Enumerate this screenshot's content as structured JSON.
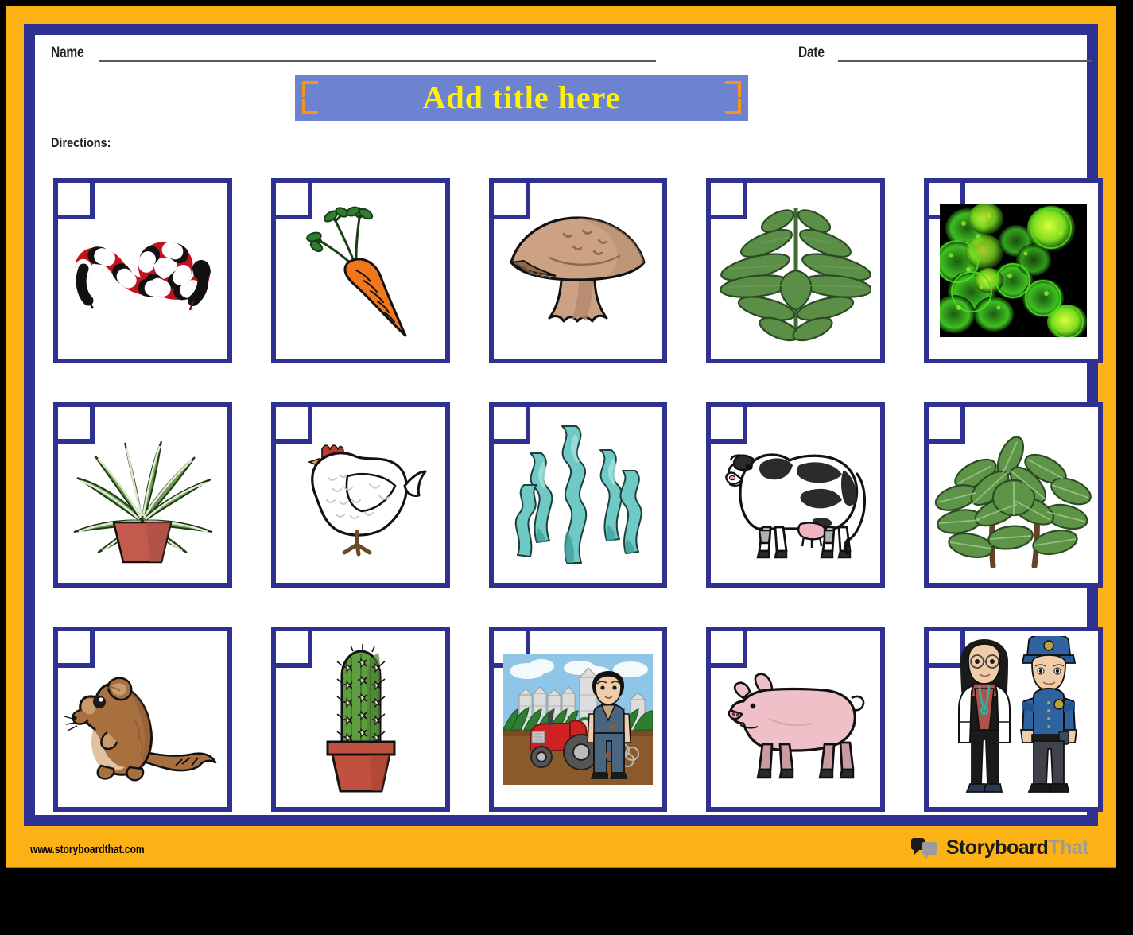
{
  "worksheet": {
    "name_label": "Name",
    "date_label": "Date",
    "title": "Add title here",
    "directions_label": "Directions:"
  },
  "footer": {
    "url": "www.storyboardthat.com",
    "logo_primary": "Storyboard",
    "logo_secondary": "That",
    "logo_icon": "speech-bubbles-icon"
  },
  "colors": {
    "outer_frame": "#FCB215",
    "inner_frame": "#2E3192",
    "title_bg": "#6D83D0",
    "title_text": "#FFF200",
    "corner_bracket": "#F7941E",
    "page_bg": "#FFFFFF"
  },
  "grid": {
    "rows": 3,
    "columns": 5,
    "cards": [
      {
        "index": 1,
        "icon": "snake-icon",
        "label": "snake",
        "checkbox_checked": false
      },
      {
        "index": 2,
        "icon": "carrot-icon",
        "label": "carrot",
        "checkbox_checked": false
      },
      {
        "index": 3,
        "icon": "mushroom-icon",
        "label": "mushroom",
        "checkbox_checked": false
      },
      {
        "index": 4,
        "icon": "leafy-plant-icon",
        "label": "leafy plant",
        "checkbox_checked": false
      },
      {
        "index": 5,
        "icon": "bacteria-micrograph-icon",
        "label": "bacteria micrograph",
        "checkbox_checked": false
      },
      {
        "index": 6,
        "icon": "spider-plant-icon",
        "label": "potted spider plant",
        "checkbox_checked": false
      },
      {
        "index": 7,
        "icon": "chicken-icon",
        "label": "chicken",
        "checkbox_checked": false
      },
      {
        "index": 8,
        "icon": "seaweed-icon",
        "label": "seaweed",
        "checkbox_checked": false
      },
      {
        "index": 9,
        "icon": "cow-icon",
        "label": "cow",
        "checkbox_checked": false
      },
      {
        "index": 10,
        "icon": "leafy-branch-icon",
        "label": "leafy branch",
        "checkbox_checked": false
      },
      {
        "index": 11,
        "icon": "mouse-icon",
        "label": "mouse",
        "checkbox_checked": false
      },
      {
        "index": 12,
        "icon": "cactus-icon",
        "label": "potted cactus",
        "checkbox_checked": false
      },
      {
        "index": 13,
        "icon": "farmer-scene-icon",
        "label": "farmer with tractor",
        "checkbox_checked": false
      },
      {
        "index": 14,
        "icon": "pig-icon",
        "label": "pig",
        "checkbox_checked": false
      },
      {
        "index": 15,
        "icon": "doctor-police-icon",
        "label": "doctor and police officer",
        "checkbox_checked": false
      }
    ]
  }
}
